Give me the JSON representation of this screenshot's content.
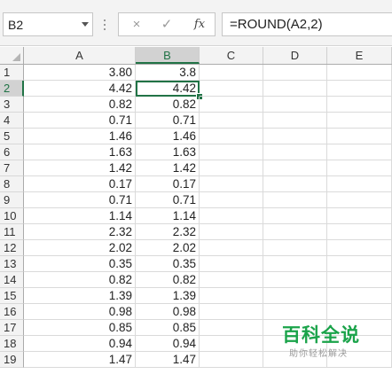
{
  "formula_bar": {
    "name_box": "B2",
    "cancel_icon": "×",
    "enter_icon": "✓",
    "fx_label": "fx",
    "formula": "=ROUND(A2,2)"
  },
  "grid": {
    "columns": [
      "A",
      "B",
      "C",
      "D",
      "E"
    ],
    "selected_column": "B",
    "selected_row": "2",
    "active_cell": "B2",
    "rows": [
      {
        "num": "1",
        "a": "3.80",
        "b": "3.8"
      },
      {
        "num": "2",
        "a": "4.42",
        "b": "4.42"
      },
      {
        "num": "3",
        "a": "0.82",
        "b": "0.82"
      },
      {
        "num": "4",
        "a": "0.71",
        "b": "0.71"
      },
      {
        "num": "5",
        "a": "1.46",
        "b": "1.46"
      },
      {
        "num": "6",
        "a": "1.63",
        "b": "1.63"
      },
      {
        "num": "7",
        "a": "1.42",
        "b": "1.42"
      },
      {
        "num": "8",
        "a": "0.17",
        "b": "0.17"
      },
      {
        "num": "9",
        "a": "0.71",
        "b": "0.71"
      },
      {
        "num": "10",
        "a": "1.14",
        "b": "1.14"
      },
      {
        "num": "11",
        "a": "2.32",
        "b": "2.32"
      },
      {
        "num": "12",
        "a": "2.02",
        "b": "2.02"
      },
      {
        "num": "13",
        "a": "0.35",
        "b": "0.35"
      },
      {
        "num": "14",
        "a": "0.82",
        "b": "0.82"
      },
      {
        "num": "15",
        "a": "1.39",
        "b": "1.39"
      },
      {
        "num": "16",
        "a": "0.98",
        "b": "0.98"
      },
      {
        "num": "17",
        "a": "0.85",
        "b": "0.85"
      },
      {
        "num": "18",
        "a": "0.94",
        "b": "0.94"
      },
      {
        "num": "19",
        "a": "1.47",
        "b": "1.47"
      }
    ]
  },
  "watermark": {
    "title": "百科全说",
    "subtitle": "助你轻松解决"
  },
  "colors": {
    "accent": "#217346",
    "watermark_green": "#1aa34a"
  }
}
